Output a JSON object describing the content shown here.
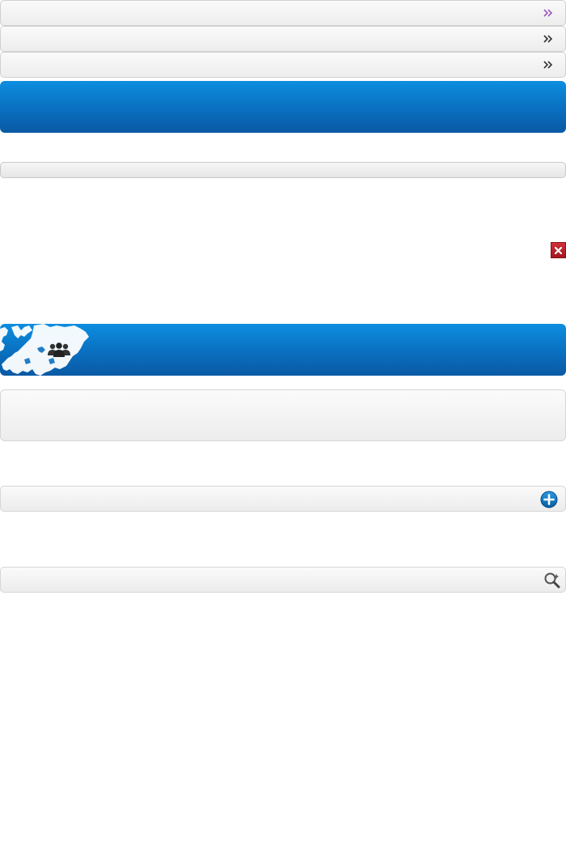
{
  "nav": {
    "items": [
      {
        "id": "nav-1",
        "chevron": "double-chevron-right-icon",
        "color": "#9b59b6"
      },
      {
        "id": "nav-2",
        "chevron": "double-chevron-right-icon",
        "color": "#333333"
      },
      {
        "id": "nav-3",
        "chevron": "double-chevron-right-icon",
        "color": "#333333"
      }
    ]
  },
  "colors": {
    "header_blue": "#0a6fbf",
    "close_red": "#b8202a",
    "plus_blue": "#0a6fbf"
  },
  "icons": {
    "close": "close-icon",
    "europe_map": "europe-map-icon",
    "people": "people-group-icon",
    "plus": "plus-circle-icon",
    "zoom": "zoom-in-icon"
  }
}
